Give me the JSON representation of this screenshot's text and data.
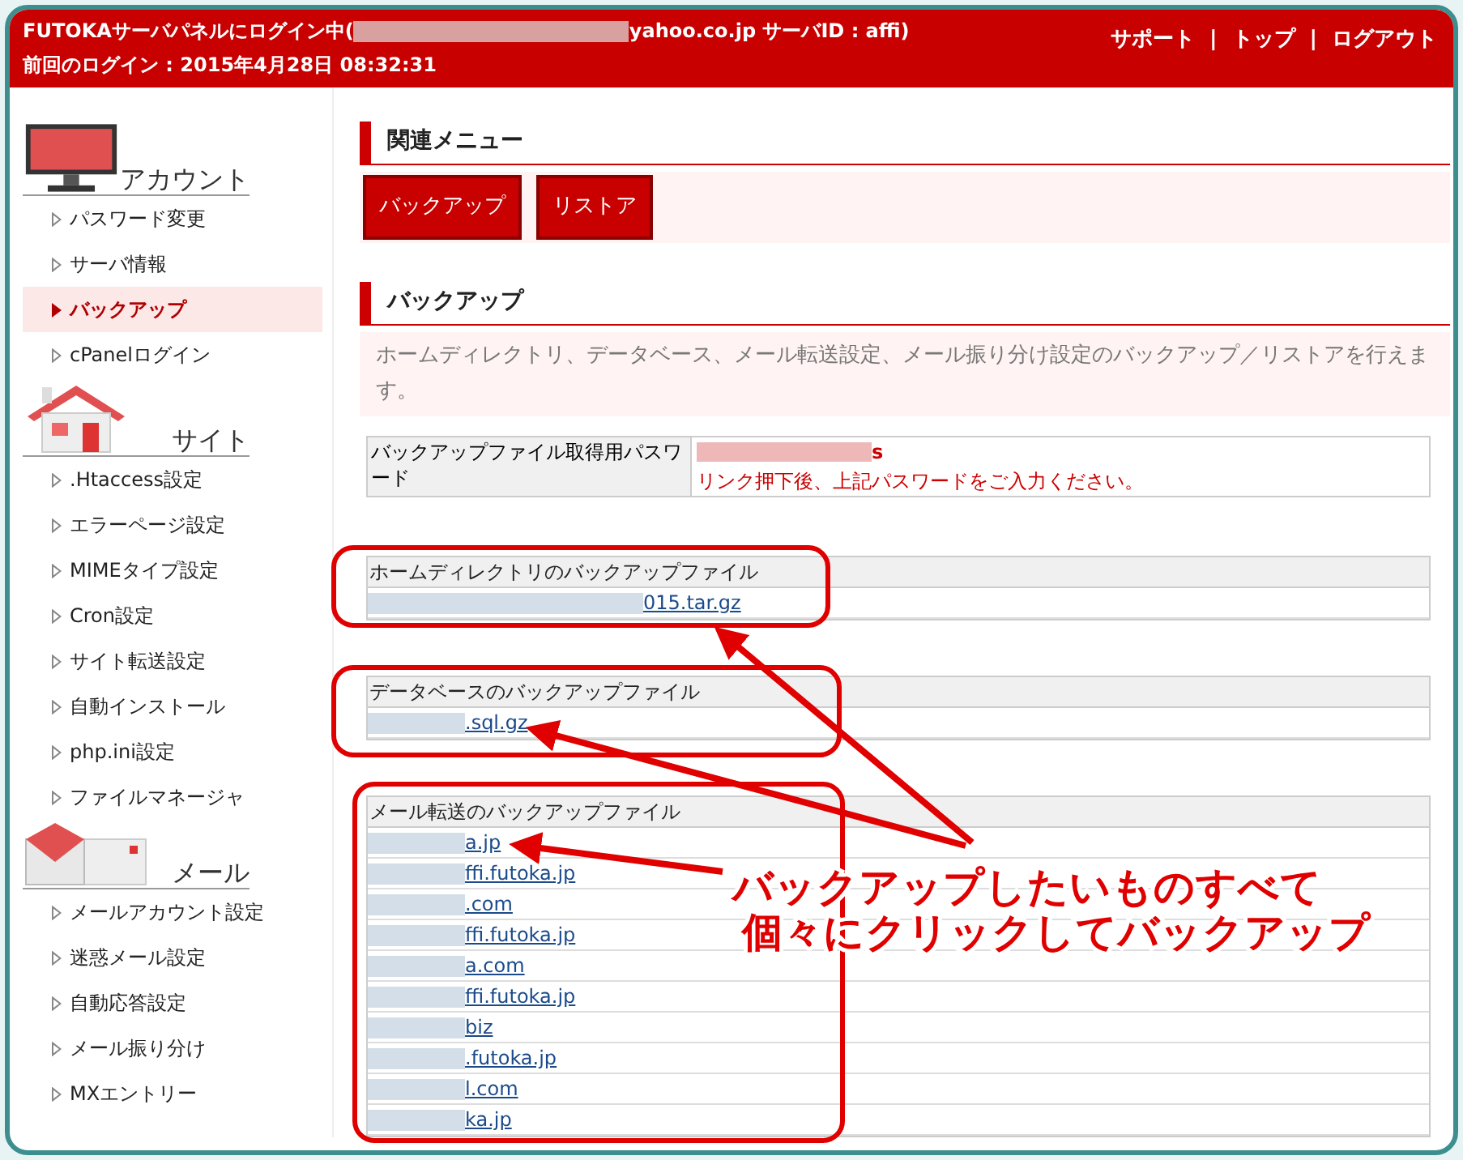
{
  "header": {
    "login_prefix": "FUTOKAサーバパネルにログイン中(",
    "login_suffix": "yahoo.co.jp サーバID : affi)",
    "last_login": "前回のログイン : 2015年4月28日 08:32:31",
    "links": [
      "サポート",
      "トップ",
      "ログアウト"
    ],
    "separators": [
      "|",
      "|"
    ]
  },
  "sidebar": {
    "sections": [
      {
        "kind": "monitor",
        "title": "アカウント",
        "items": [
          {
            "label": "パスワード変更",
            "selected": false
          },
          {
            "label": "サーバ情報",
            "selected": false
          },
          {
            "label": "バックアップ",
            "selected": true
          },
          {
            "label": "cPanelログイン",
            "selected": false
          }
        ]
      },
      {
        "kind": "house",
        "title": "サイト",
        "items": [
          {
            "label": ".Htaccess設定",
            "selected": false
          },
          {
            "label": "エラーページ設定",
            "selected": false
          },
          {
            "label": "MIMEタイプ設定",
            "selected": false
          },
          {
            "label": "Cron設定",
            "selected": false
          },
          {
            "label": "サイト転送設定",
            "selected": false
          },
          {
            "label": "自動インストール",
            "selected": false
          },
          {
            "label": "php.ini設定",
            "selected": false
          },
          {
            "label": "ファイルマネージャ",
            "selected": false
          }
        ]
      },
      {
        "kind": "mail",
        "title": "メール",
        "items": [
          {
            "label": "メールアカウント設定",
            "selected": false
          },
          {
            "label": "迷惑メール設定",
            "selected": false
          },
          {
            "label": "自動応答設定",
            "selected": false
          },
          {
            "label": "メール振り分け",
            "selected": false
          },
          {
            "label": "MXエントリー",
            "selected": false
          }
        ]
      }
    ]
  },
  "related_menu": {
    "title": "関連メニュー",
    "buttons": [
      "バックアップ",
      "リストア"
    ]
  },
  "backup": {
    "title": "バックアップ",
    "description": "ホームディレクトリ、データベース、メール転送設定、メール振り分け設定のバックアップ／リストアを行えます。",
    "password": {
      "label": "バックアップファイル取得用パスワード",
      "value_suffix": "s",
      "note": "リンク押下後、上記パスワードをご入力ください。"
    },
    "tables": [
      {
        "heading": "ホームディレクトリのバックアップファイル",
        "files": [
          "015.tar.gz"
        ]
      },
      {
        "heading": "データベースのバックアップファイル",
        "files": [
          ".sql.gz"
        ]
      },
      {
        "heading": "メール転送のバックアップファイル",
        "files": [
          "a.jp",
          "ffi.futoka.jp",
          ".com",
          "ffi.futoka.jp",
          "a.com",
          "ffi.futoka.jp",
          "biz",
          ".futoka.jp",
          "l.com",
          "ka.jp"
        ]
      }
    ]
  },
  "annotation": {
    "lines": [
      "バックアップしたいものすべて",
      "個々にクリックしてバックアップ"
    ]
  }
}
